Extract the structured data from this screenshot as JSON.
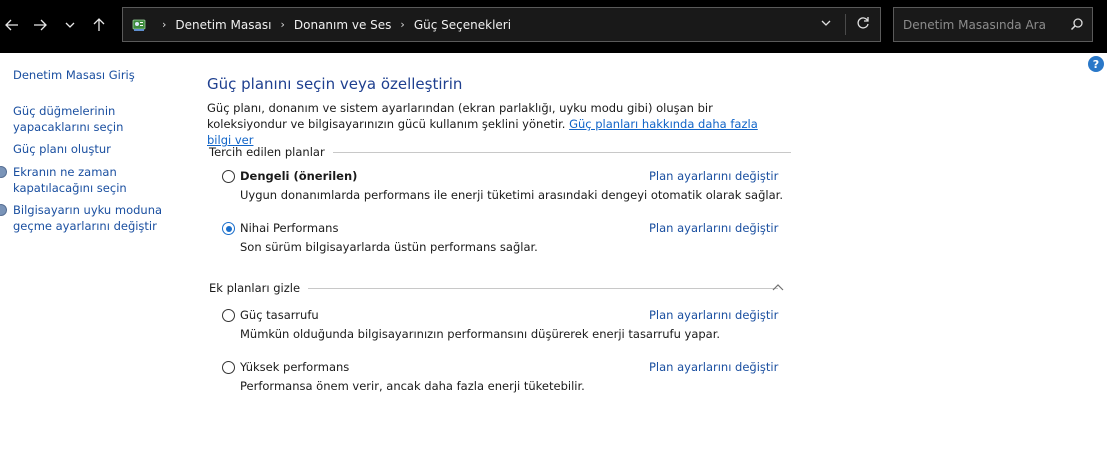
{
  "address_bar": {
    "breadcrumbs": [
      "Denetim Masası",
      "Donanım ve Ses",
      "Güç Seçenekleri"
    ]
  },
  "search": {
    "placeholder": "Denetim Masasında Ara"
  },
  "sidebar": {
    "home": "Denetim Masası Giriş",
    "links": [
      "Güç düğmelerinin yapacaklarını seçin",
      "Güç planı oluştur",
      "Ekranın ne zaman kapatılacağını seçin",
      "Bilgisayarın uyku moduna geçme ayarlarını değiştir"
    ]
  },
  "help": {
    "label": "?"
  },
  "main": {
    "title": "Güç planını seçin veya özelleştirin",
    "intro": "Güç planı, donanım ve sistem ayarlarından (ekran parlaklığı, uyku modu gibi) oluşan bir koleksiyondur ve bilgisayarınızın gücü kullanım şeklini yönetir.",
    "intro_link": "Güç planları hakkında daha fazla bilgi ver",
    "preferred_header": "Tercih edilen planlar",
    "extra_header": "Ek planları gizle",
    "plans": [
      {
        "name": "Dengeli (önerilen)",
        "desc": "Uygun donanımlarda performans ile enerji tüketimi arasındaki dengeyi otomatik olarak sağlar.",
        "link": "Plan ayarlarını değiştir",
        "selected": false
      },
      {
        "name": "Nihai Performans",
        "desc": "Son sürüm bilgisayarlarda üstün performans sağlar.",
        "link": "Plan ayarlarını değiştir",
        "selected": true
      },
      {
        "name": "Güç tasarrufu",
        "desc": "Mümkün olduğunda bilgisayarınızın performansını düşürerek enerji tasarrufu yapar.",
        "link": "Plan ayarlarını değiştir",
        "selected": false
      },
      {
        "name": "Yüksek performans",
        "desc": "Performansa önem verir, ancak daha fazla enerji tüketebilir.",
        "link": "Plan ayarlarını değiştir",
        "selected": false
      }
    ]
  }
}
